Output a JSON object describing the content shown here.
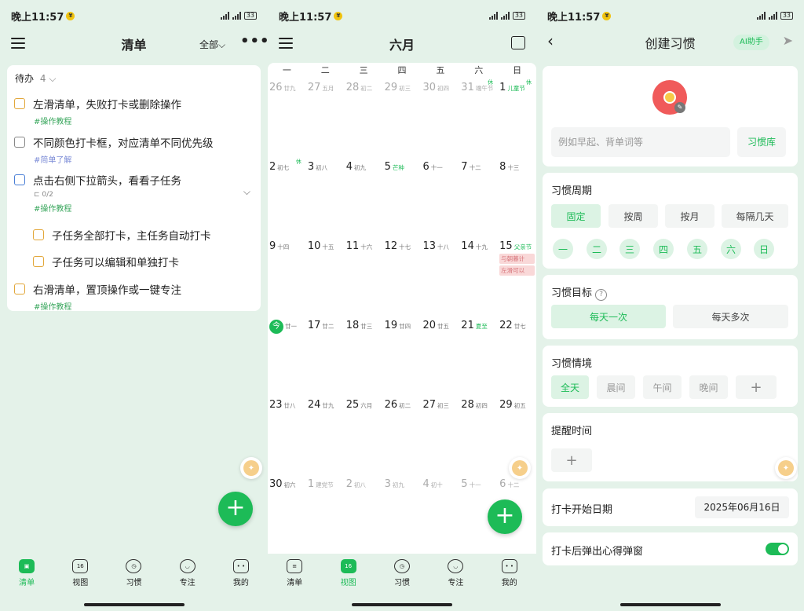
{
  "status": {
    "time": "晚上11:57",
    "battery": "33"
  },
  "list_screen": {
    "title": "清单",
    "filter": "全部",
    "section": {
      "label": "待办",
      "count": "4"
    },
    "tasks": [
      {
        "text": "左滑清单，失败打卡或删除操作",
        "tag": "#操作教程",
        "color": "#e2a73a"
      },
      {
        "text": "不同颜色打卡框，对应清单不同优先级",
        "tag": "#简单了解",
        "color": "#888888"
      },
      {
        "text": "点击右侧下拉箭头，看看子任务",
        "tag": "#操作教程",
        "sub": "0/2",
        "color": "#4a7fd6"
      },
      {
        "text": "子任务全部打卡，主任务自动打卡",
        "color": "#e2a73a"
      },
      {
        "text": "子任务可以编辑和单独打卡",
        "color": "#e2a73a"
      },
      {
        "text": "右滑清单，置顶操作或一键专注",
        "tag": "#操作教程",
        "color": "#e2a73a"
      }
    ]
  },
  "nav": {
    "tabs": [
      "清单",
      "视图",
      "习惯",
      "专注",
      "我的"
    ],
    "calendar_icon_day": "16"
  },
  "calendar": {
    "month": "六月",
    "weekdays": [
      "一",
      "二",
      "三",
      "四",
      "五",
      "六",
      "日"
    ],
    "today_label": "今",
    "rows": [
      [
        {
          "n": "26",
          "l": "廿九",
          "dim": true
        },
        {
          "n": "27",
          "l": "五月",
          "dim": true
        },
        {
          "n": "28",
          "l": "初二",
          "dim": true
        },
        {
          "n": "29",
          "l": "初三",
          "dim": true
        },
        {
          "n": "30",
          "l": "初四",
          "dim": true
        },
        {
          "n": "31",
          "l": "端午节",
          "dim": true,
          "ban": "休"
        },
        {
          "n": "1",
          "l": "儿童节",
          "fest": true,
          "ban": "休"
        }
      ],
      [
        {
          "n": "2",
          "l": "初七",
          "ban": "休"
        },
        {
          "n": "3",
          "l": "初八"
        },
        {
          "n": "4",
          "l": "初九"
        },
        {
          "n": "5",
          "l": "芒种",
          "fest": true
        },
        {
          "n": "6",
          "l": "十一"
        },
        {
          "n": "7",
          "l": "十二"
        },
        {
          "n": "8",
          "l": "十三"
        }
      ],
      [
        {
          "n": "9",
          "l": "十四"
        },
        {
          "n": "10",
          "l": "十五"
        },
        {
          "n": "11",
          "l": "十六"
        },
        {
          "n": "12",
          "l": "十七"
        },
        {
          "n": "13",
          "l": "十八"
        },
        {
          "n": "14",
          "l": "十九"
        },
        {
          "n": "15",
          "l": "父亲节",
          "fest": true,
          "events": [
            "与朝暮计",
            "左滑可以"
          ]
        }
      ],
      [
        {
          "n": "16",
          "l": "廿一",
          "today": true
        },
        {
          "n": "17",
          "l": "廿二"
        },
        {
          "n": "18",
          "l": "廿三"
        },
        {
          "n": "19",
          "l": "廿四"
        },
        {
          "n": "20",
          "l": "廿五"
        },
        {
          "n": "21",
          "l": "夏至",
          "fest": true
        },
        {
          "n": "22",
          "l": "廿七"
        }
      ],
      [
        {
          "n": "23",
          "l": "廿八"
        },
        {
          "n": "24",
          "l": "廿九"
        },
        {
          "n": "25",
          "l": "六月"
        },
        {
          "n": "26",
          "l": "初二"
        },
        {
          "n": "27",
          "l": "初三"
        },
        {
          "n": "28",
          "l": "初四"
        },
        {
          "n": "29",
          "l": "初五"
        }
      ],
      [
        {
          "n": "30",
          "l": "初六"
        },
        {
          "n": "1",
          "l": "建党节",
          "dim": true
        },
        {
          "n": "2",
          "l": "初八",
          "dim": true
        },
        {
          "n": "3",
          "l": "初九",
          "dim": true
        },
        {
          "n": "4",
          "l": "初十",
          "dim": true
        },
        {
          "n": "5",
          "l": "十一",
          "dim": true
        },
        {
          "n": "6",
          "l": "十二",
          "dim": true
        }
      ]
    ]
  },
  "habit": {
    "title": "创建习惯",
    "ai_button": "AI助手",
    "name_placeholder": "例如早起、背单词等",
    "library_button": "习惯库",
    "cycle": {
      "label": "习惯周期",
      "options": [
        "固定",
        "按周",
        "按月",
        "每隔几天"
      ],
      "days": [
        "一",
        "二",
        "三",
        "四",
        "五",
        "六",
        "日"
      ]
    },
    "goal": {
      "label": "习惯目标",
      "options": [
        "每天一次",
        "每天多次"
      ]
    },
    "context": {
      "label": "习惯情境",
      "options": [
        "全天",
        "晨间",
        "午间",
        "晚间"
      ]
    },
    "reminder": {
      "label": "提醒时间"
    },
    "start": {
      "label": "打卡开始日期",
      "value": "2025年06月16日"
    },
    "popup": {
      "label": "打卡后弹出心得弹窗",
      "enabled": true
    },
    "accent": "#1dbb57"
  }
}
